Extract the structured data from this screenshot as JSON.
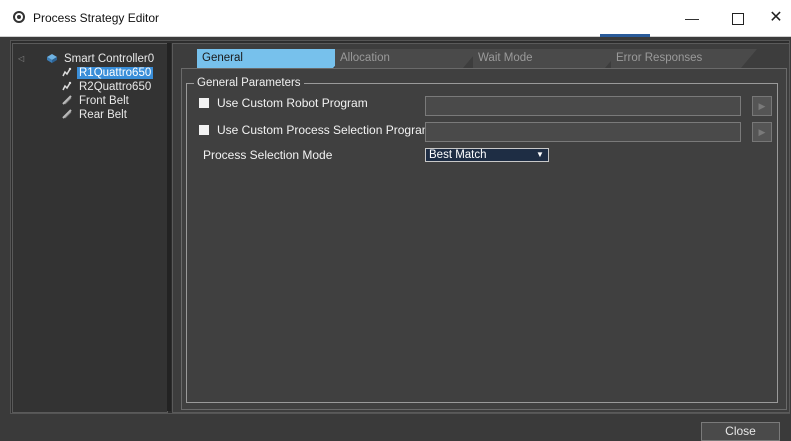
{
  "window": {
    "title": "Process Strategy Editor",
    "minimize_glyph": "—",
    "close_glyph": "✕"
  },
  "tree": {
    "root": {
      "label": "Smart Controller0",
      "icon": "controller-icon"
    },
    "items": [
      {
        "label": "R1Quattro650",
        "icon": "robot-icon",
        "selected": true
      },
      {
        "label": "R2Quattro650",
        "icon": "robot-icon",
        "selected": false
      },
      {
        "label": "Front Belt",
        "icon": "belt-icon",
        "selected": false
      },
      {
        "label": "Rear Belt",
        "icon": "belt-icon",
        "selected": false
      }
    ]
  },
  "tabs": [
    {
      "label": "General",
      "active": true
    },
    {
      "label": "Allocation",
      "active": false
    },
    {
      "label": "Wait Mode",
      "active": false
    },
    {
      "label": "Error Responses",
      "active": false
    }
  ],
  "general": {
    "group_title": "General Parameters",
    "custom_robot_program": {
      "label": "Use Custom Robot Program",
      "checked": false,
      "value": ""
    },
    "custom_process_selection_program": {
      "label": "Use Custom Process Selection Program",
      "checked": false,
      "value": ""
    },
    "process_selection_mode": {
      "label": "Process Selection Mode",
      "selected": "Best Match"
    }
  },
  "footer": {
    "close_label": "Close"
  },
  "colors": {
    "active_tab": "#77c1ec",
    "selection": "#3a8ed8",
    "panel_bg": "#404040"
  }
}
